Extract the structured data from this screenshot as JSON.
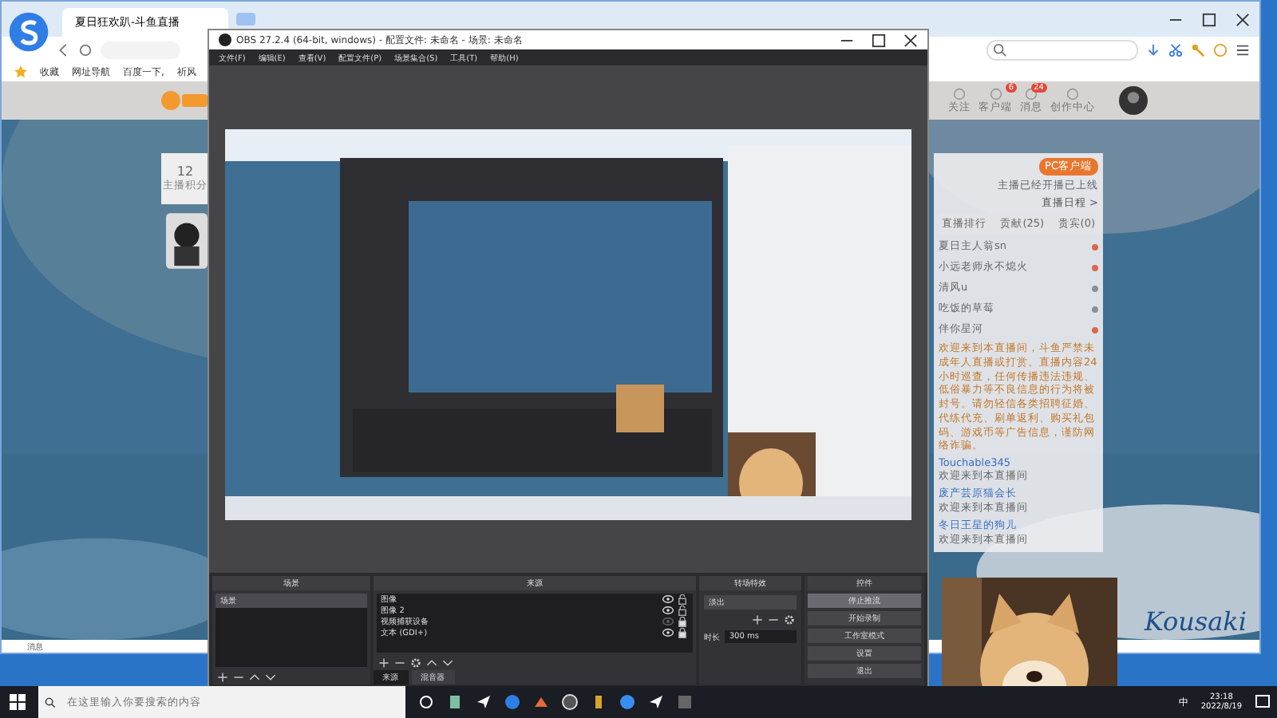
{
  "browser": {
    "tab_title": "夏日狂欢趴-斗鱼直播",
    "bookmarks": [
      "收藏",
      "网址导航",
      "百度一下,",
      "祈风"
    ],
    "site_header": {
      "nav": [
        "关注",
        "客户端",
        "消息",
        "创作中心"
      ],
      "badges": [
        "6",
        "24"
      ]
    },
    "follow_card": {
      "count": "12",
      "label": "主播积分"
    },
    "side_panel": {
      "client_button": "PC客户端",
      "client_note": "主播已经开播已上线",
      "tabs": [
        "直播排行",
        "贡献(25)",
        "贵宾(0)"
      ],
      "rank_link": "直播日程 >",
      "ranks": [
        {
          "name": "夏日主人翁sn",
          "color": "#d9694a"
        },
        {
          "name": "小远老师永不熄火",
          "color": "#d9694a"
        },
        {
          "name": "清风u",
          "color": "#8a8f9a"
        },
        {
          "name": "吃饭的草莓",
          "color": "#8a8f9a"
        },
        {
          "name": "伴你星河",
          "color": "#d9694a"
        }
      ],
      "notice": "欢迎来到本直播间，斗鱼严禁未成年人直播或打赏。直播内容24小时巡查，任何传播违法违规、低俗暴力等不良信息的行为将被封号。请勿轻信各类招聘征婚、代练代充、刷单返利、购买礼包码、游戏币等广告信息，谨防网络诈骗。",
      "chat": [
        {
          "user": "Touchable345",
          "text": "欢迎来到本直播间"
        },
        {
          "user": "废产芸原猫会长",
          "text": "欢迎来到本直播间"
        },
        {
          "user": "冬日王星的狗儿",
          "text": "欢迎来到本直播间"
        }
      ]
    },
    "status": "消息"
  },
  "obs": {
    "title": "OBS 27.2.4 (64-bit, windows) - 配置文件: 未命名 - 场景: 未命名",
    "menu": [
      "文件(F)",
      "编辑(E)",
      "查看(V)",
      "配置文件(P)",
      "场景集合(S)",
      "工具(T)",
      "帮助(H)"
    ],
    "scenes": {
      "title": "场景",
      "items": [
        {
          "name": "场景",
          "selected": true
        }
      ]
    },
    "sources": {
      "title": "来源",
      "items": [
        {
          "name": "图像",
          "visible": true,
          "locked": false
        },
        {
          "name": "图像 2",
          "visible": true,
          "locked": false
        },
        {
          "name": "视频捕获设备",
          "visible": false,
          "locked": true
        },
        {
          "name": "文本 (GDI+)",
          "visible": true,
          "locked": true
        }
      ],
      "tabs": [
        {
          "label": "来源",
          "selected": true
        },
        {
          "label": "混音器",
          "selected": false
        }
      ]
    },
    "transitions": {
      "title": "转场特效",
      "type": "淡出",
      "duration_label": "时长",
      "duration": "300 ms"
    },
    "controls": {
      "title": "控件",
      "buttons": [
        {
          "label": "停止推流",
          "active": true
        },
        {
          "label": "开始录制",
          "active": false
        },
        {
          "label": "工作室模式",
          "active": false
        },
        {
          "label": "设置",
          "active": false
        },
        {
          "label": "退出",
          "active": false
        }
      ]
    }
  },
  "signature": "Kousaki",
  "taskbar": {
    "search_placeholder": "在这里输入你要搜索的内容",
    "ime": "中",
    "time": "23:18",
    "date": "2022/8/19"
  }
}
